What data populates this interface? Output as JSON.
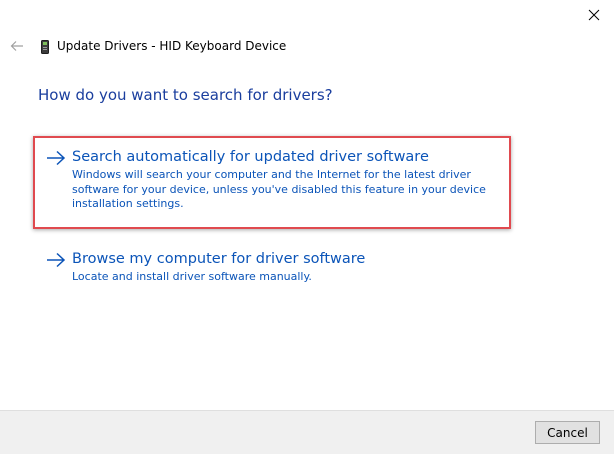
{
  "window": {
    "title": "Update Drivers - HID Keyboard Device",
    "close_icon": "close-icon",
    "back_icon": "back-arrow-icon",
    "device_icon": "keyboard-device-icon"
  },
  "question": "How do you want to search for drivers?",
  "options": [
    {
      "title": "Search automatically for updated driver software",
      "description": "Windows will search your computer and the Internet for the latest driver software for your device, unless you've disabled this feature in your device installation settings.",
      "icon": "arrow-right-icon",
      "highlighted": true
    },
    {
      "title": "Browse my computer for driver software",
      "description": "Locate and install driver software manually.",
      "icon": "arrow-right-icon",
      "highlighted": false
    }
  ],
  "footer": {
    "cancel_label": "Cancel"
  },
  "colors": {
    "link": "#0b54b8",
    "heading": "#1a3e9e",
    "highlight_border": "#e04a4f",
    "footer_bg": "#f0f0f0"
  }
}
